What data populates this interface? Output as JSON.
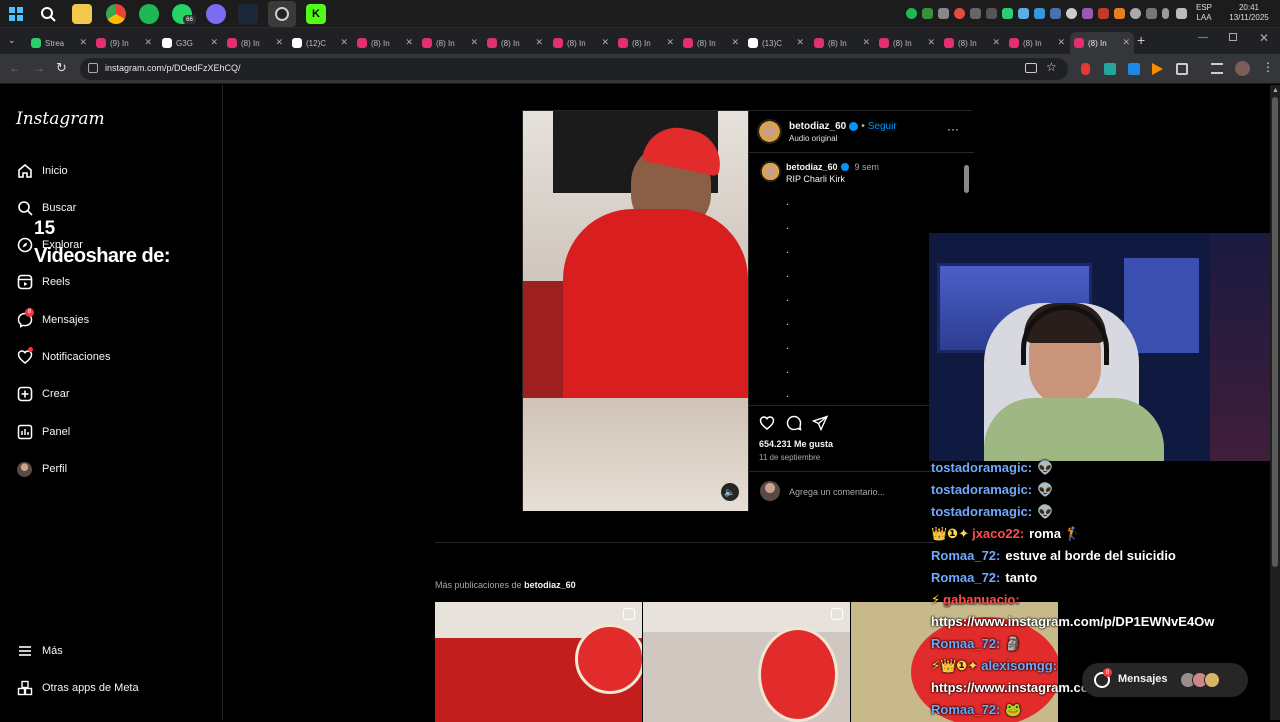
{
  "tray": {
    "lang_top": "ESP",
    "lang_bottom": "LAA",
    "time": "20:41",
    "date": "13/11/2025"
  },
  "taskbar": {
    "whatsapp_badge": "66"
  },
  "tabs": [
    {
      "label": "Strea",
      "fav": "#2ecc71"
    },
    {
      "label": "(9) In",
      "fav": "#e1306c"
    },
    {
      "label": "G3G",
      "fav": "#ffffff"
    },
    {
      "label": "(8) In",
      "fav": "#e1306c"
    },
    {
      "label": "(12)C",
      "fav": "#ffffff"
    },
    {
      "label": "(8) In",
      "fav": "#e1306c"
    },
    {
      "label": "(8) In",
      "fav": "#e1306c"
    },
    {
      "label": "(8) In",
      "fav": "#e1306c"
    },
    {
      "label": "(8) In",
      "fav": "#e1306c"
    },
    {
      "label": "(8) In",
      "fav": "#e1306c"
    },
    {
      "label": "(8) In",
      "fav": "#e1306c"
    },
    {
      "label": "(13)C",
      "fav": "#ffffff"
    },
    {
      "label": "(8) In",
      "fav": "#e1306c"
    },
    {
      "label": "(8) In",
      "fav": "#e1306c"
    },
    {
      "label": "(8) In",
      "fav": "#e1306c"
    },
    {
      "label": "(8) In",
      "fav": "#e1306c"
    },
    {
      "label": "(8) In",
      "fav": "#e1306c"
    }
  ],
  "address": {
    "url": "instagram.com/p/DOedFzXEhCQ/"
  },
  "sidebar": {
    "logo": "Instagram",
    "items": [
      {
        "label": "Inicio",
        "icon": "home-icon"
      },
      {
        "label": "Buscar",
        "icon": "search-icon"
      },
      {
        "label": "Explorar",
        "icon": "compass-icon"
      },
      {
        "label": "Reels",
        "icon": "reels-icon"
      },
      {
        "label": "Mensajes",
        "icon": "messenger-icon",
        "badge": "8"
      },
      {
        "label": "Notificaciones",
        "icon": "heart-icon"
      },
      {
        "label": "Crear",
        "icon": "plus-square-icon"
      },
      {
        "label": "Panel",
        "icon": "chart-icon"
      },
      {
        "label": "Perfil",
        "icon": "avatar-icon"
      }
    ],
    "more": "Más",
    "meta_apps": "Otras apps de Meta"
  },
  "overlay": {
    "count": "15",
    "label": "Videoshare de:"
  },
  "post": {
    "username": "betodiaz_60",
    "follow": "Seguir",
    "audio": "Audio original",
    "caption_user": "betodiaz_60",
    "caption_time": "9 sem",
    "caption_text": "RIP Charli Kirk",
    "likes": "654.231 Me gusta",
    "date": "11 de septiembre",
    "comment_placeholder": "Agrega un comentario..."
  },
  "more_posts": {
    "prefix": "Más publicaciones de",
    "user": "betodiaz_60"
  },
  "chat": [
    {
      "user": "tostadoramagic:",
      "color": "#6fa8ff",
      "msg": "👽"
    },
    {
      "user": "tostadoramagic:",
      "color": "#6fa8ff",
      "msg": "👽"
    },
    {
      "user": "tostadoramagic:",
      "color": "#6fa8ff",
      "msg": "👽"
    },
    {
      "user": "jxaco22:",
      "color": "#ff4d4d",
      "msg": "roma 🏌",
      "badges": "👑❶✦"
    },
    {
      "user": "Romaa_72:",
      "color": "#6fa8ff",
      "msg": "estuve al borde del suicidio",
      "badges": ""
    },
    {
      "user": "Romaa_72:",
      "color": "#6fa8ff",
      "msg": "tanto"
    },
    {
      "user": "gabanuacio:",
      "color": "#ff4d4d",
      "msg": "",
      "badges": "⚡"
    },
    {
      "user": "",
      "color": "#ffffff",
      "msg": "https://www.instagram.com/p/DP1EWNvE4Ow"
    },
    {
      "user": "Romaa_72:",
      "color": "#6fa8ff",
      "msg": "🗿"
    },
    {
      "user": "alexisomgg:",
      "color": "#6fa8ff",
      "msg": "",
      "badges": "⚡👑❶✦"
    },
    {
      "user": "",
      "color": "#ffffff",
      "msg": "https://www.instagram.com/p/DQ2nVwOEsrR"
    },
    {
      "user": "Romaa_72:",
      "color": "#6fa8ff",
      "msg": "🐸"
    }
  ],
  "messages_pill": {
    "label": "Mensajes",
    "badge": "8"
  },
  "colors": {
    "accent_blue": "#0095f6",
    "badge_red": "#ff3040",
    "shirt_red": "#d81e1e"
  }
}
